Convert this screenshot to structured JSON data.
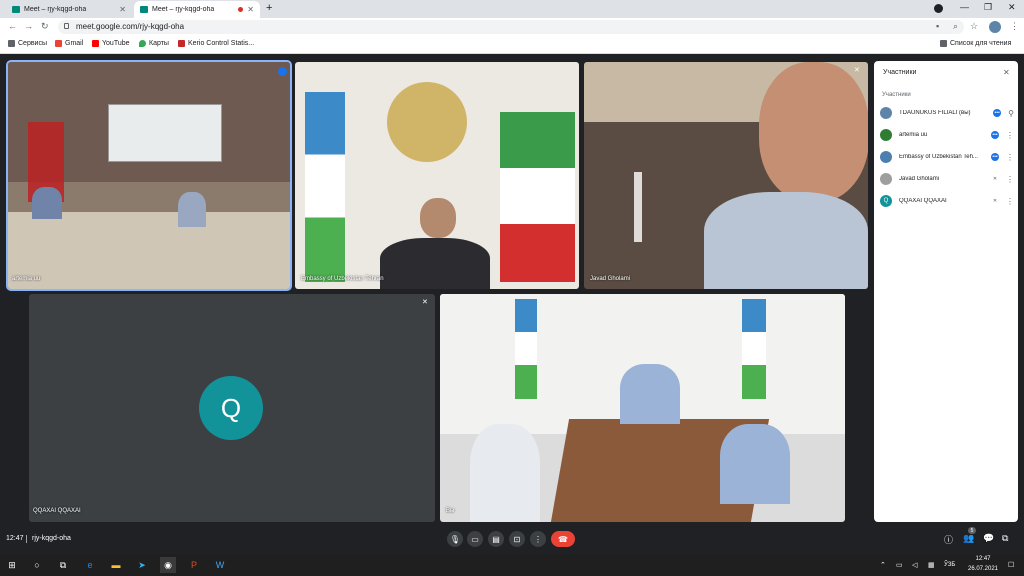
{
  "browser": {
    "tabs": [
      {
        "title": "Meet – rjy-kqgd-oha",
        "active": false
      },
      {
        "title": "Meet – rjy-kqgd-oha",
        "active": true
      }
    ],
    "new_tab_glyph": "+",
    "url": "meet.google.com/rjy-kqgd-oha",
    "bookmarks_label": "Сервисы",
    "bookmarks": [
      "Gmail",
      "YouTube",
      "Карты",
      "Kerio Control Statis..."
    ],
    "reading_list": "Список для чтения"
  },
  "tiles": [
    {
      "name": "artemia uu"
    },
    {
      "name": "Embassy of Uzbekistan Tehran"
    },
    {
      "name": "Javad Gholami"
    },
    {
      "name": "QQAXAI QQAXAI",
      "avatar_letter": "Q"
    },
    {
      "name": "Вы"
    }
  ],
  "panel": {
    "title": "Участники",
    "section": "Участники",
    "participants": [
      {
        "name": "TDAUNUKUS FILIALI (вы)",
        "color": "#5f84a9"
      },
      {
        "name": "artemia uu",
        "color": "#2e7d32"
      },
      {
        "name": "Embassy of Uzbekistan Teh...",
        "color": "#4a7fb0"
      },
      {
        "name": "Javad Gholami",
        "color": "#9e9e9e"
      },
      {
        "name": "QQAXAI QQAXAI",
        "color": "#12939a",
        "letter": "Q"
      }
    ]
  },
  "meeting": {
    "time": "12:47",
    "code": "rjy-kqgd-oha",
    "participant_count": "5"
  },
  "taskbar": {
    "lang": "ЎЗБ",
    "time": "12:47",
    "date": "26.07.2021"
  },
  "colors": {
    "accent_teal": "#12939a",
    "end_call_red": "#ea4335",
    "active_speaker_blue": "#8ab4f8"
  }
}
